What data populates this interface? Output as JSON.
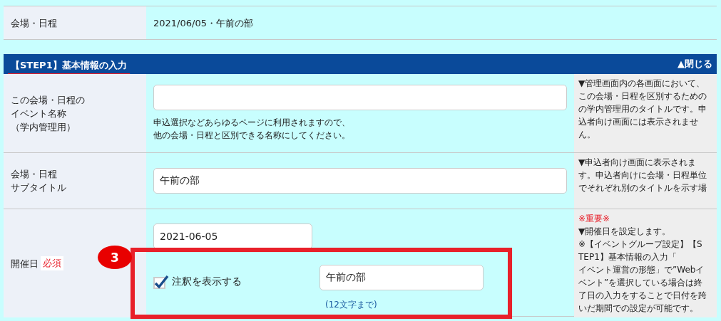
{
  "summary_row": {
    "label": "会場・日程",
    "value": "2021/06/05・午前の部"
  },
  "section": {
    "title": "【STEP1】基本情報の入力",
    "toggle": "▲閉じる",
    "expanded": true
  },
  "rows": [
    {
      "kind": "text",
      "label_lines": [
        "この会場・日程の",
        "イベント名称",
        "（学内管理用）"
      ],
      "field": {},
      "hint_lines": [
        "申込選択などあらゆるページに利用されますので、",
        "他の会場・日程と区別できる名称にしてください。"
      ],
      "help_lines": [
        "▼管理画面内の各画面において、",
        "この会場・日程を区別するための",
        "の学内管理用のタイトルです。申",
        "込者向け画面には表示されませ",
        "ん。"
      ]
    },
    {
      "kind": "text",
      "label_lines": [
        "会場・日程",
        "サブタイトル"
      ],
      "field": {
        "value": "午前の部"
      },
      "help_lines": [
        "▼申込者向け画面に表示されま",
        "す。申込者向けに会場・日程単位",
        "でそれぞれ別のタイトルを示す場"
      ]
    },
    {
      "kind": "date",
      "label_lines": [
        "開催日"
      ],
      "required": "必須",
      "field": {
        "value": "2021-06-05"
      },
      "annotation": {
        "checked": true,
        "label": "注釈を表示する",
        "value": "午前の部",
        "hint": "(12文字まで)"
      },
      "important": "※重要※",
      "help_lines": [
        "▼開催日を設定します。",
        "※【イベントグループ設定】【S",
        "TEP1】基本情報の入力「",
        "イベント運営の形態」で”Webイ",
        "ベント”を選択している場合は終",
        "了日の入力をすることで日付を跨",
        "いだ期間での設定が可能です。"
      ]
    }
  ],
  "callout": {
    "number": "3"
  }
}
